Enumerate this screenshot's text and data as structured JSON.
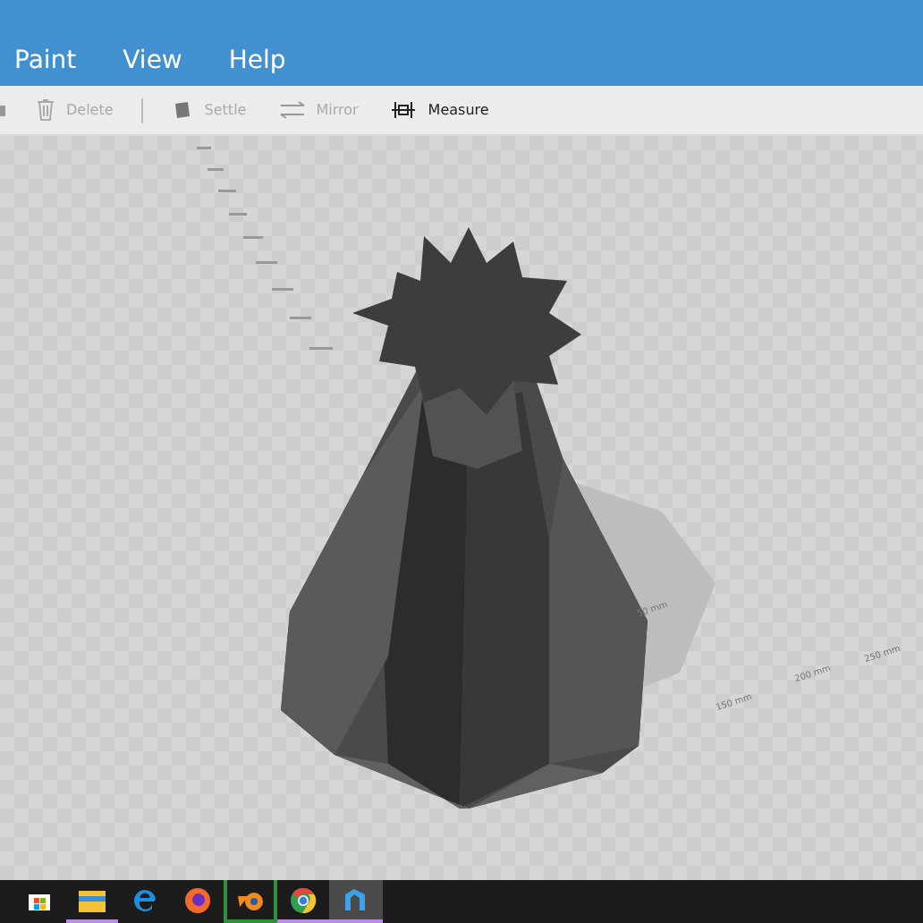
{
  "menu": [
    {
      "label": "Paint"
    },
    {
      "label": "View"
    },
    {
      "label": "Help"
    }
  ],
  "toolbar": [
    {
      "kind": "delete",
      "label": "Delete",
      "disabled": true
    },
    {
      "kind": "separator"
    },
    {
      "kind": "settle",
      "label": "Settle",
      "disabled": true
    },
    {
      "kind": "mirror",
      "label": "Mirror",
      "disabled": true
    },
    {
      "kind": "measure",
      "label": "Measure",
      "disabled": false
    }
  ],
  "axis_labels": [
    "50 mm",
    "150 mm",
    "200 mm",
    "250 mm"
  ],
  "taskbar": [
    {
      "kind": "store",
      "running": false,
      "active": false
    },
    {
      "kind": "explorer",
      "running": true,
      "active": false
    },
    {
      "kind": "edge",
      "running": false,
      "active": false
    },
    {
      "kind": "firefox",
      "running": false,
      "active": false
    },
    {
      "kind": "blender",
      "running": true,
      "active": true
    },
    {
      "kind": "chrome",
      "running": true,
      "active": false
    },
    {
      "kind": "builder",
      "running": true,
      "active": true
    }
  ]
}
